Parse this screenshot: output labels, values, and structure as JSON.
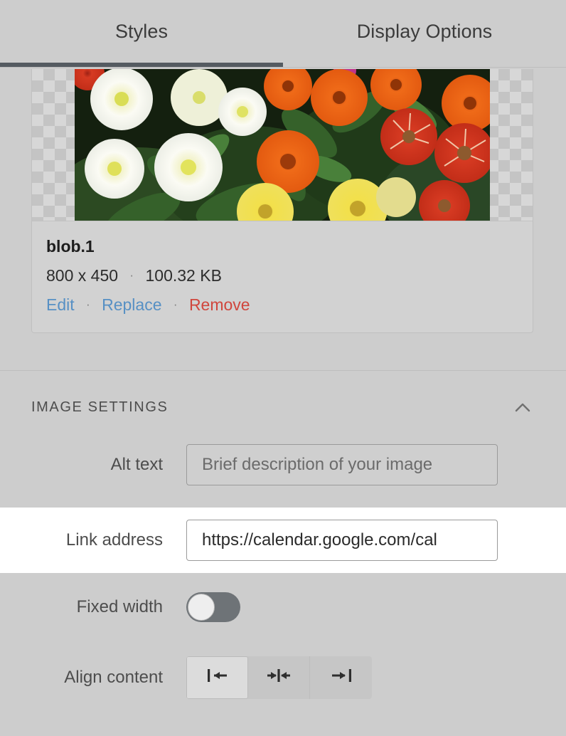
{
  "tabs": [
    {
      "label": "Styles",
      "active": true
    },
    {
      "label": "Display Options",
      "active": false
    }
  ],
  "file_card": {
    "name": "blob.1",
    "dimensions": "800 x 450",
    "separator": "·",
    "filesize": "100.32 KB",
    "actions": {
      "edit": "Edit",
      "replace": "Replace",
      "remove": "Remove"
    },
    "image_alt": "Zinnia flowers - white, orange, red and yellow blooms"
  },
  "image_settings": {
    "title": "IMAGE SETTINGS",
    "collapse_icon": "chevron-up-icon",
    "fields": {
      "alt_text": {
        "label": "Alt text",
        "placeholder": "Brief description of your image",
        "value": ""
      },
      "link_address": {
        "label": "Link address",
        "placeholder": "",
        "value": "https://calendar.google.com/cal"
      },
      "fixed_width": {
        "label": "Fixed width",
        "enabled": false
      },
      "align_content": {
        "label": "Align content",
        "selected": "left",
        "options": [
          {
            "value": "left",
            "icon": "align-left-icon"
          },
          {
            "value": "center",
            "icon": "align-center-icon"
          },
          {
            "value": "right",
            "icon": "align-right-icon"
          }
        ]
      }
    }
  },
  "colors": {
    "background": "#cdcdcd",
    "active_tab_underline": "#555b61",
    "link_blue": "#5790c4",
    "remove_red": "#d0463d",
    "toggle_track": "#6e7377",
    "text_primary": "#1d1d1d",
    "text_secondary": "#4d4d4d"
  }
}
